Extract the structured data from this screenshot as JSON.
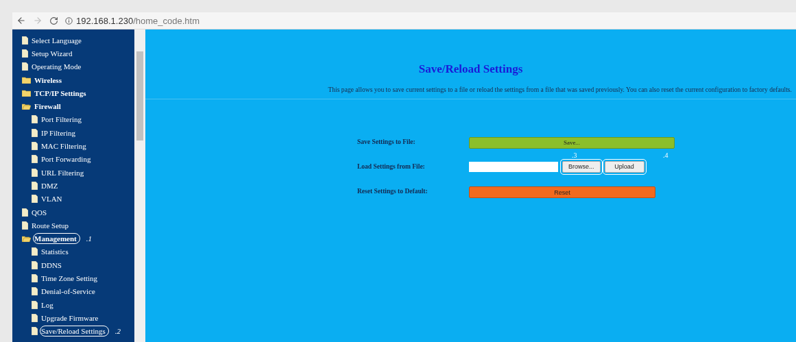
{
  "browser": {
    "url_host": "192.168.1.230",
    "url_path": "/home_code.htm"
  },
  "sidebar": {
    "items": [
      {
        "label": "Select Language",
        "kind": "page"
      },
      {
        "label": "Setup Wizard",
        "kind": "page"
      },
      {
        "label": "Operating Mode",
        "kind": "page"
      },
      {
        "label": "Wireless",
        "kind": "folder",
        "expanded": false
      },
      {
        "label": "TCP/IP Settings",
        "kind": "folder",
        "expanded": false
      },
      {
        "label": "Firewall",
        "kind": "folder",
        "expanded": true,
        "children": [
          {
            "label": "Port Filtering",
            "kind": "page"
          },
          {
            "label": "IP Filtering",
            "kind": "page"
          },
          {
            "label": "MAC Filtering",
            "kind": "page"
          },
          {
            "label": "Port Forwarding",
            "kind": "page"
          },
          {
            "label": "URL Filtering",
            "kind": "page"
          },
          {
            "label": "DMZ",
            "kind": "page"
          },
          {
            "label": "VLAN",
            "kind": "page"
          }
        ]
      },
      {
        "label": "QOS",
        "kind": "page"
      },
      {
        "label": "Route Setup",
        "kind": "page"
      },
      {
        "label": "Management",
        "kind": "folder",
        "expanded": true,
        "circled": true,
        "note": ".1",
        "children": [
          {
            "label": "Statistics",
            "kind": "page"
          },
          {
            "label": "DDNS",
            "kind": "page"
          },
          {
            "label": "Time Zone Setting",
            "kind": "page"
          },
          {
            "label": "Denial-of-Service",
            "kind": "page"
          },
          {
            "label": "Log",
            "kind": "page"
          },
          {
            "label": "Upgrade Firmware",
            "kind": "page"
          },
          {
            "label": "Save/Reload Settings",
            "kind": "page",
            "circled": true,
            "note": ".2"
          }
        ]
      }
    ]
  },
  "main": {
    "title": "Save/Reload Settings",
    "description": "This page allows you to save current settings to a file or reload the settings from a file that was saved previously. You can also reset the current configuration to factory defaults.",
    "rows": [
      {
        "label": "Save Settings to File:",
        "kind": "save",
        "button": "Save..."
      },
      {
        "label": "Load Settings from File:",
        "kind": "load",
        "browse": "Browse...",
        "browse_note": ".3",
        "upload": "Upload",
        "upload_note": ".4"
      },
      {
        "label": "Reset Settings to Default:",
        "kind": "reset",
        "button": "Reset"
      }
    ]
  }
}
